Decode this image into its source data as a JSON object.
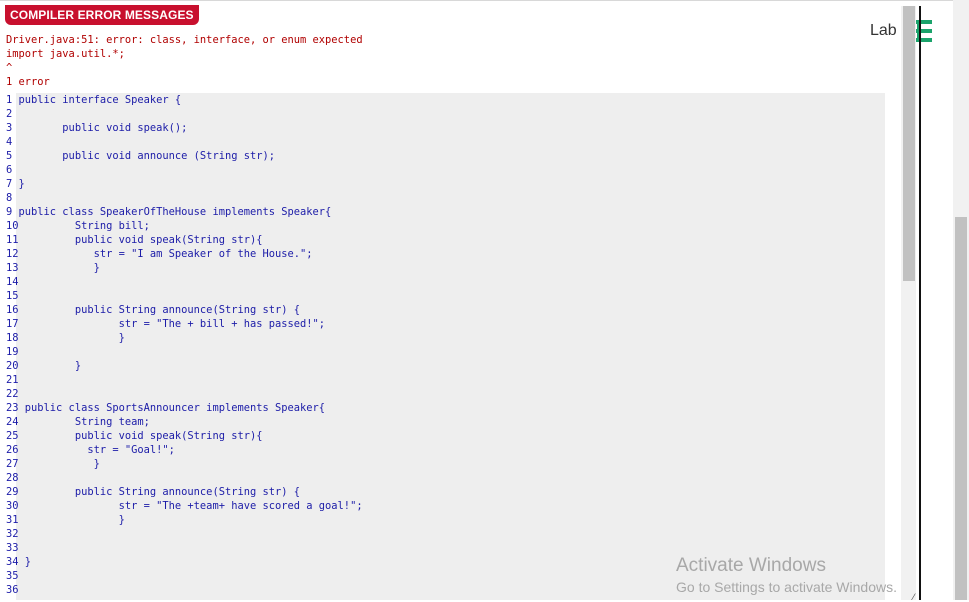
{
  "header": {
    "badge": "COMPILER ERROR MESSAGES"
  },
  "error_lines": [
    "Driver.java:51: error: class, interface, or enum expected",
    "import java.util.*;",
    "^",
    "1 error"
  ],
  "code_lines": [
    "1 public interface Speaker {",
    "2",
    "3        public void speak();",
    "4",
    "5        public void announce (String str);",
    "6",
    "7 }",
    "8",
    "9 public class SpeakerOfTheHouse implements Speaker{",
    "10         String bill;",
    "11         public void speak(String str){",
    "12            str = \"I am Speaker of the House.\";",
    "13            }",
    "14",
    "15",
    "16         public String announce(String str) {",
    "17                str = \"The + bill + has passed!\";",
    "18                }",
    "19",
    "20         }",
    "21",
    "22",
    "23 public class SportsAnnouncer implements Speaker{",
    "24         String team;",
    "25         public void speak(String str){",
    "26           str = \"Goal!\";",
    "27            }",
    "28",
    "29         public String announce(String str) {",
    "30                str = \"The +team+ have scored a goal!\";",
    "31                }",
    "32",
    "33",
    "34 }",
    "35",
    "36"
  ],
  "side_panel": {
    "label": "Lab",
    "menu_icon": "hamburger-menu-icon",
    "accent": "#1aa36b"
  },
  "watermark": {
    "title": "Activate Windows",
    "subtitle": "Go to Settings to activate Windows."
  },
  "colors": {
    "badge_bg": "#c8102e",
    "error_text": "#b00000",
    "code_text": "#1c1ca8",
    "code_bg": "#eeeeee"
  }
}
